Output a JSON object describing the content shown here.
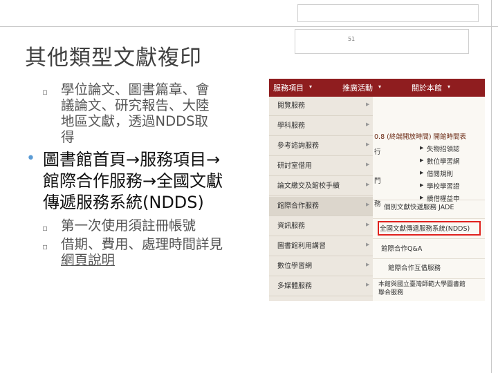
{
  "slide": {
    "page_number": "51",
    "title": "其他類型文獻複印",
    "bullets": {
      "sub1_lines": [
        "學位論文、圖書篇章、會",
        "議論文、研究報告、大陸",
        "地區文獻，透過NDDS取",
        "得"
      ],
      "main_lines": [
        "圖書館首頁→服務項目→",
        "館際合作服務→全國文獻",
        "傳遞服務系統(NDDS)"
      ],
      "sub2": "第一次使用須註冊帳號",
      "sub3_line1": "借期、費用、處理時間詳見",
      "sub3_link": "網頁說明"
    }
  },
  "screenshot": {
    "topnav": [
      "服務項目",
      "推廣活動",
      "關於本館"
    ],
    "sidebar": [
      "閱覽服務",
      "學科服務",
      "參考諮詢服務",
      "研討室借用",
      "論文繳交及館校手續",
      "館際合作服務",
      "資訊服務",
      "圖書館利用講習",
      "數位學習網",
      "多媒體服務"
    ],
    "content": {
      "hours_snippet": "0.8 (終端開放時間)  開館時間表",
      "left_partials": [
        "行",
        "門",
        "務"
      ],
      "right_list": [
        "失物招領認",
        "數位學習網",
        "借閱規則",
        "學校學習證",
        "續借權益申"
      ],
      "ill_title": "個別文獻快遞服務 JADE",
      "ndds_link": "全國文獻傳遞服務系統(NDDS)",
      "qa_link": "館際合作Q&A",
      "ill_service": "館際合作互借服務",
      "last_item": [
        "本館與國立臺灣師範大學圖書館",
        "聯合服務"
      ]
    }
  }
}
